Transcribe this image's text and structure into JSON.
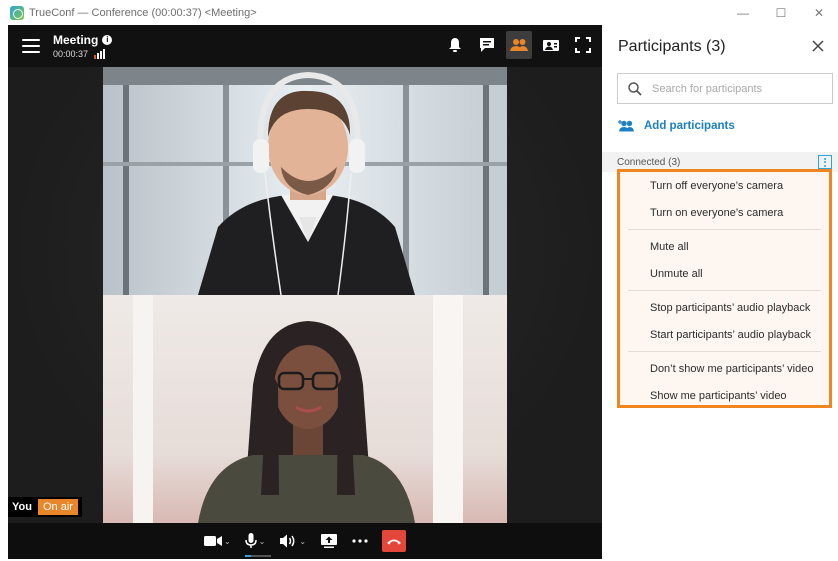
{
  "window": {
    "title": "TrueConf — Conference (00:00:37) <Meeting>",
    "controls": {
      "minimize": "—",
      "maximize": "☐",
      "close": "✕"
    }
  },
  "meeting": {
    "title": "Meeting",
    "elapsed": "00:00:37"
  },
  "self": {
    "name": "You",
    "status": "On air"
  },
  "toolbar_icons": [
    "bell-icon",
    "chat-icon",
    "participants-icon",
    "content-share-icon",
    "fullscreen-icon"
  ],
  "bottom_icons": [
    "camera-icon",
    "microphone-icon",
    "speaker-icon",
    "share-screen-icon",
    "more-icon",
    "hangup-icon"
  ],
  "panel": {
    "title": "Participants (3)",
    "search_placeholder": "Search for participants",
    "add_label": "Add participants",
    "connected_label": "Connected (3)"
  },
  "context_menu": {
    "groups": [
      [
        "Turn off everyone’s camera",
        "Turn on everyone’s camera"
      ],
      [
        "Mute all",
        "Unmute all"
      ],
      [
        "Stop participants’ audio playback",
        "Start participants’ audio playback"
      ],
      [
        "Don’t show me participants’ video",
        "Show me participants’ video"
      ]
    ]
  },
  "colors": {
    "accent": "#f0861f",
    "link": "#1b7fc4",
    "hangup": "#e5463b",
    "active_toolbar": "#e8862a",
    "mic_level": "#2da3e0"
  }
}
